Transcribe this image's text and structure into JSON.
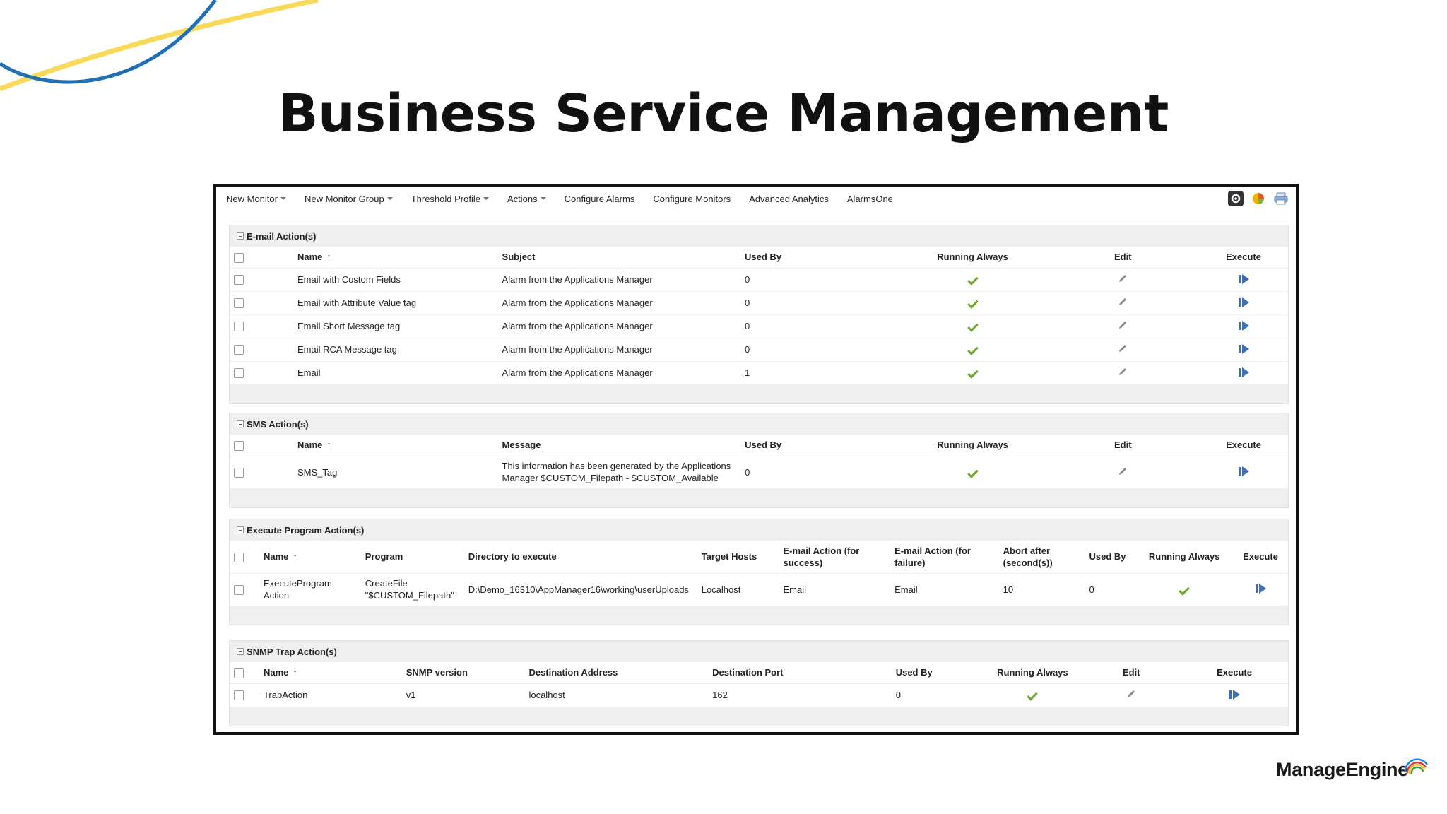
{
  "slide": {
    "title": "Business Service Management",
    "logo_text": "ManageEngine",
    "brand_colors": {
      "yellow": "#f7d548",
      "blue": "#1e6fb3"
    }
  },
  "toolbar": {
    "items": [
      {
        "label": "New Monitor",
        "dropdown": true
      },
      {
        "label": "New Monitor Group",
        "dropdown": true
      },
      {
        "label": "Threshold Profile",
        "dropdown": true
      },
      {
        "label": "Actions",
        "dropdown": true
      },
      {
        "label": "Configure Alarms",
        "dropdown": false
      },
      {
        "label": "Configure Monitors",
        "dropdown": false
      },
      {
        "label": "Advanced Analytics",
        "dropdown": false
      },
      {
        "label": "AlarmsOne",
        "dropdown": false
      }
    ],
    "icons": [
      "settings-icon",
      "pie-chart-icon",
      "print-icon"
    ]
  },
  "email_actions": {
    "title": "E-mail Action(s)",
    "columns": {
      "name": "Name",
      "subject": "Subject",
      "used_by": "Used By",
      "running_always": "Running Always",
      "edit": "Edit",
      "execute": "Execute"
    },
    "rows": [
      {
        "name": "Email with Custom Fields",
        "subject": "Alarm from the Applications Manager",
        "used_by": "0"
      },
      {
        "name": "Email with Attribute Value tag",
        "subject": "Alarm from the Applications Manager",
        "used_by": "0"
      },
      {
        "name": "Email Short Message tag",
        "subject": "Alarm from the Applications Manager",
        "used_by": "0"
      },
      {
        "name": "Email RCA Message tag",
        "subject": "Alarm from the Applications Manager",
        "used_by": "0"
      },
      {
        "name": "Email",
        "subject": "Alarm from the Applications Manager",
        "used_by": "1"
      }
    ]
  },
  "sms_actions": {
    "title": "SMS Action(s)",
    "columns": {
      "name": "Name",
      "message": "Message",
      "used_by": "Used By",
      "running_always": "Running Always",
      "edit": "Edit",
      "execute": "Execute"
    },
    "rows": [
      {
        "name": "SMS_Tag",
        "message_line1": "This information has been generated by the Applications",
        "message_line2": "Manager $CUSTOM_Filepath - $CUSTOM_Available",
        "used_by": "0"
      }
    ]
  },
  "exec_actions": {
    "title": "Execute Program Action(s)",
    "columns": {
      "name": "Name",
      "program": "Program",
      "directory": "Directory to execute",
      "target_hosts": "Target Hosts",
      "email_success_1": "E-mail Action (for",
      "email_success_2": "success)",
      "email_failure_1": "E-mail Action (for",
      "email_failure_2": "failure)",
      "abort_1": "Abort after",
      "abort_2": "(second(s))",
      "used_by": "Used By",
      "running_always": "Running Always",
      "execute": "Execute"
    },
    "rows": [
      {
        "name_1": "ExecuteProgram",
        "name_2": "Action",
        "program_1": "CreateFile",
        "program_2": "\"$CUSTOM_Filepath\"",
        "directory": "D:\\Demo_16310\\AppManager16\\working\\userUploads",
        "target_hosts": "Localhost",
        "email_success": "Email",
        "email_failure": "Email",
        "abort_after": "10",
        "used_by": "0"
      }
    ]
  },
  "snmp_actions": {
    "title": "SNMP Trap Action(s)",
    "columns": {
      "name": "Name",
      "version": "SNMP version",
      "destination_address": "Destination Address",
      "destination_port": "Destination Port",
      "used_by": "Used By",
      "running_always": "Running Always",
      "edit": "Edit",
      "execute": "Execute"
    },
    "rows": [
      {
        "name": "TrapAction",
        "version": "v1",
        "destination_address": "localhost",
        "destination_port": "162",
        "used_by": "0"
      }
    ]
  }
}
